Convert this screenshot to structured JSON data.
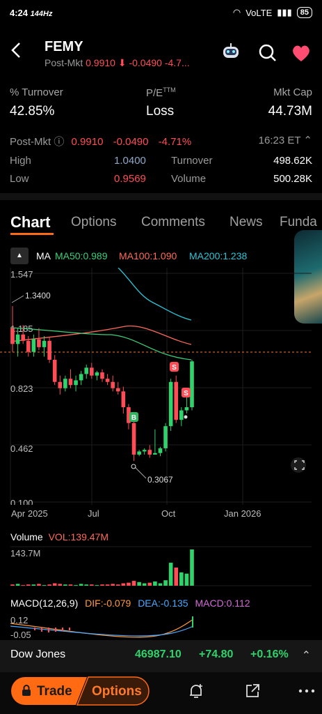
{
  "status_bar": {
    "time": "4:24",
    "refresh": "144Hz",
    "network": "VoLTE",
    "battery": "85"
  },
  "header": {
    "symbol": "FEMY",
    "post_label": "Post-Mkt",
    "price": "0.9910",
    "change": "-0.0490",
    "change_pct": "-4.7..."
  },
  "stats": {
    "turnover_label": "% Turnover",
    "turnover_value": "42.85%",
    "pe_label": "P/E",
    "pe_sup": "TTM",
    "pe_value": "Loss",
    "mktcap_label": "Mkt Cap",
    "mktcap_value": "44.73M",
    "post_label": "Post-Mkt",
    "post_price": "0.9910",
    "post_change": "-0.0490",
    "post_pct": "-4.71%",
    "post_time": "16:23 ET",
    "high_label": "High",
    "high_value": "1.0400",
    "turnover2_label": "Turnover",
    "turnover2_value": "498.62K",
    "low_label": "Low",
    "low_value": "0.9569",
    "volume_label": "Volume",
    "volume_value": "500.28K"
  },
  "tabs": [
    "Chart",
    "Options",
    "Comments",
    "News",
    "Funda"
  ],
  "ma": {
    "label": "MA",
    "ma50": "MA50:0.989",
    "ma100": "MA100:1.090",
    "ma200": "MA200:1.238"
  },
  "colors": {
    "up": "#2fd36b",
    "down": "#ff4d57",
    "ma50": "#3ad07a",
    "ma100": "#ff6a5a",
    "ma200": "#29c6d8",
    "accent": "#ff6a13"
  },
  "chart_data": {
    "type": "candlestick",
    "y_ticks": [
      "1.547",
      "1.185",
      "0.823",
      "0.462",
      "0.100"
    ],
    "x_ticks": [
      "Apr 2025",
      "Jul",
      "Oct",
      "Jan 2026"
    ],
    "ylim": [
      0.1,
      1.547
    ],
    "annotations": {
      "high": "1.3400",
      "low": "0.3067"
    },
    "last_price": 0.991,
    "candles": [
      [
        1.2,
        1.34,
        1.05,
        1.1
      ],
      [
        1.1,
        1.2,
        1.02,
        1.16
      ],
      [
        1.16,
        1.22,
        1.1,
        1.12
      ],
      [
        1.12,
        1.15,
        1.02,
        1.05
      ],
      [
        1.05,
        1.16,
        1.02,
        1.13
      ],
      [
        1.13,
        1.2,
        1.06,
        1.08
      ],
      [
        1.08,
        1.15,
        1.02,
        1.12
      ],
      [
        1.12,
        1.14,
        0.98,
        1.0
      ],
      [
        1.0,
        1.03,
        0.84,
        0.86
      ],
      [
        0.86,
        0.9,
        0.78,
        0.82
      ],
      [
        0.82,
        0.9,
        0.8,
        0.88
      ],
      [
        0.88,
        0.94,
        0.82,
        0.84
      ],
      [
        0.84,
        0.9,
        0.8,
        0.87
      ],
      [
        0.87,
        0.93,
        0.84,
        0.91
      ],
      [
        0.91,
        0.97,
        0.88,
        0.95
      ],
      [
        0.95,
        0.98,
        0.88,
        0.9
      ],
      [
        0.9,
        0.93,
        0.87,
        0.92
      ],
      [
        0.92,
        0.94,
        0.86,
        0.88
      ],
      [
        0.88,
        0.91,
        0.84,
        0.86
      ],
      [
        0.86,
        0.9,
        0.8,
        0.82
      ],
      [
        0.82,
        0.86,
        0.78,
        0.8
      ],
      [
        0.8,
        0.83,
        0.66,
        0.7
      ],
      [
        0.7,
        0.72,
        0.56,
        0.6
      ],
      [
        0.6,
        0.62,
        0.36,
        0.4
      ],
      [
        0.4,
        0.43,
        0.39,
        0.42
      ],
      [
        0.42,
        0.44,
        0.4,
        0.43
      ],
      [
        0.43,
        0.46,
        0.38,
        0.4
      ],
      [
        0.4,
        0.56,
        0.4,
        0.41
      ],
      [
        0.41,
        0.45,
        0.39,
        0.44
      ],
      [
        0.44,
        0.6,
        0.42,
        0.58
      ],
      [
        0.58,
        0.88,
        0.55,
        0.86
      ],
      [
        0.86,
        0.9,
        0.6,
        0.62
      ],
      [
        0.62,
        0.7,
        0.58,
        0.68
      ],
      [
        0.68,
        0.8,
        0.66,
        0.7
      ],
      [
        0.7,
        1.0,
        0.68,
        0.99
      ]
    ],
    "volume_label": "Volume",
    "volume_value": "VOL:139.47M",
    "volume_max": "143.7M",
    "volumes": [
      2,
      3,
      1,
      2,
      2,
      3,
      1,
      2,
      4,
      3,
      2,
      2,
      1,
      3,
      2,
      2,
      1,
      2,
      2,
      3,
      2,
      4,
      5,
      8,
      6,
      4,
      5,
      7,
      4,
      9,
      38,
      30,
      22,
      20,
      60
    ],
    "volume_up": [
      0,
      1,
      0,
      0,
      1,
      0,
      1,
      0,
      0,
      0,
      1,
      0,
      1,
      1,
      1,
      0,
      1,
      0,
      0,
      0,
      0,
      0,
      0,
      0,
      1,
      1,
      0,
      1,
      1,
      1,
      1,
      0,
      1,
      1,
      1
    ],
    "macd": {
      "title": "MACD(12,26,9)",
      "dif": "DIF:-0.079",
      "dea": "DEA:-0.135",
      "macd": "MACD:0.112",
      "ticks": [
        "0.12",
        "-0.05"
      ]
    }
  },
  "ticker": {
    "name": "Dow Jones",
    "value": "46987.10",
    "change": "+74.80",
    "pct": "+0.16%"
  },
  "bottom": {
    "trade": "Trade",
    "options": "Options"
  }
}
